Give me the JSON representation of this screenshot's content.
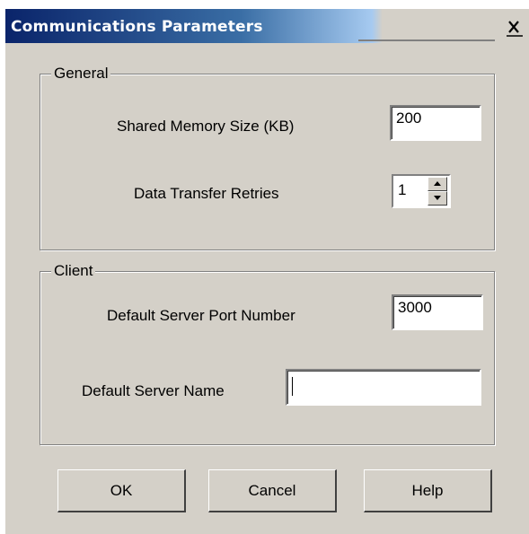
{
  "window": {
    "title": "Communications Parameters",
    "close_icon": "close-icon"
  },
  "general": {
    "legend": "General",
    "shared_memory_label": "Shared Memory Size (KB)",
    "shared_memory_value": "200",
    "retries_label": "Data Transfer Retries",
    "retries_value": "1"
  },
  "client": {
    "legend": "Client",
    "port_label": "Default Server Port Number",
    "port_value": "3000",
    "server_name_label": "Default Server Name",
    "server_name_value": ""
  },
  "buttons": {
    "ok": "OK",
    "cancel": "Cancel",
    "help": "Help"
  },
  "colors": {
    "title_bar_start": "#0a246a",
    "title_bar_end": "#a6caf0",
    "face": "#d4d0c8"
  }
}
